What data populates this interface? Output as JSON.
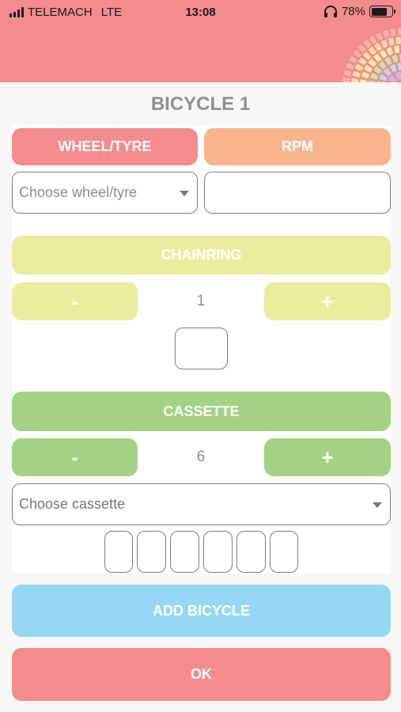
{
  "status_bar": {
    "carrier": "TELEMACH",
    "network": "LTE",
    "time": "13:08",
    "battery": "78%",
    "battery_level": 0.78,
    "icons": [
      "signal-icon",
      "headphones-icon",
      "battery-icon"
    ]
  },
  "page": {
    "title": "BICYCLE 1"
  },
  "wheel": {
    "header_label": "WHEEL/TYRE",
    "select_placeholder": "Choose wheel/tyre"
  },
  "rpm": {
    "header_label": "RPM",
    "value": ""
  },
  "chainring": {
    "header_label": "CHAINRING",
    "minus_label": "-",
    "plus_label": "+",
    "count": "1"
  },
  "cassette": {
    "header_label": "CASSETTE",
    "minus_label": "-",
    "plus_label": "+",
    "count": "6",
    "select_placeholder": "Choose cassette"
  },
  "actions": {
    "add_bicycle_label": "ADD BICYCLE",
    "ok_label": "OK"
  },
  "colors": {
    "header_bg": "#f38b8f",
    "wheel": "#f38b8f",
    "rpm": "#f9b48d",
    "chainring": "#ecec9e",
    "cassette": "#a3d285",
    "add_bicycle": "#96d8f4",
    "ok": "#f38b8f"
  }
}
